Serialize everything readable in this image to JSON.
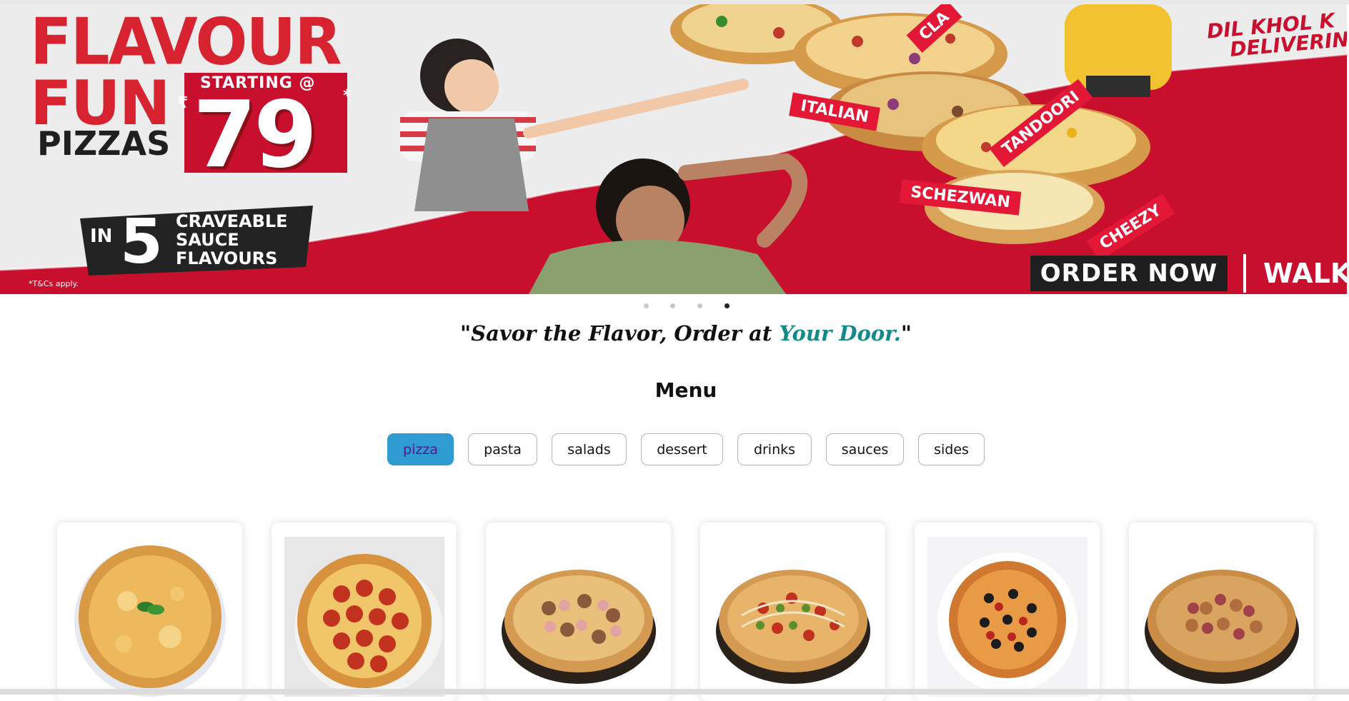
{
  "banner": {
    "headline_1": "FLAVOUR",
    "headline_2": "FUN",
    "headline_3": "PIZZAS",
    "starting_label": "STARTING @",
    "currency": "₹",
    "price": "79",
    "price_mark": "*",
    "sauce_in": "IN",
    "sauce_count": "5",
    "sauce_line_1": "CRAVEABLE",
    "sauce_line_2": "SAUCE",
    "sauce_line_3": "FLAVOURS",
    "terms": "*T&Cs apply.",
    "brand_slogan_1": "DIL KHOL K",
    "brand_slogan_2": "DELIVERIN",
    "tags": [
      "CLA",
      "ITALIAN",
      "TANDOORI",
      "SCHEZWAN",
      "CHEEZY"
    ],
    "order_button": "ORDER NOW",
    "walk_label": "WALK"
  },
  "carousel": {
    "slide_count": 4,
    "active_index": 3
  },
  "tagline": {
    "open_quote": "\"",
    "main": "Savor the Flavor, Order at ",
    "accent": "Your Door.",
    "close_quote": "\"",
    "accent_color": "#138a8a"
  },
  "menu": {
    "title": "Menu",
    "categories": [
      {
        "label": "pizza",
        "active": true
      },
      {
        "label": "pasta",
        "active": false
      },
      {
        "label": "salads",
        "active": false
      },
      {
        "label": "dessert",
        "active": false
      },
      {
        "label": "drinks",
        "active": false
      },
      {
        "label": "sauces",
        "active": false
      },
      {
        "label": "sides",
        "active": false
      }
    ],
    "active_color": "#2f9bd0"
  },
  "products": [
    {
      "image": "margherita-pizza-image"
    },
    {
      "image": "pepperoni-pizza-image"
    },
    {
      "image": "mushroom-chicken-pizza-image"
    },
    {
      "image": "spicy-veggie-pizza-image"
    },
    {
      "image": "olive-supreme-pizza-image"
    },
    {
      "image": "onion-chicken-pizza-image"
    }
  ]
}
